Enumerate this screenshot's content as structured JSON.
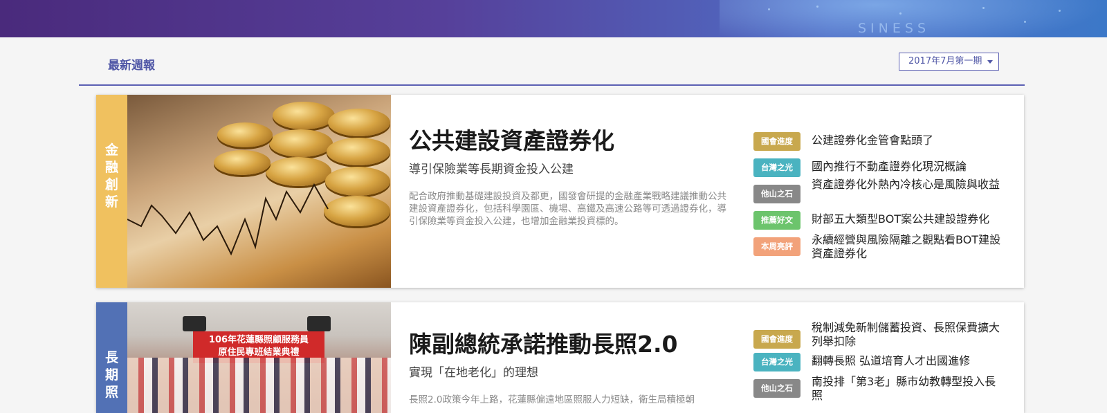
{
  "banner": {
    "text": "SINESS"
  },
  "header": {
    "section_title": "最新週報",
    "issue_selector": "2017年7月第一期"
  },
  "articles": [
    {
      "category": "金\n融\n創\n新",
      "title": "公共建設資產證券化",
      "subtitle": "導引保險業等長期資金投入公建",
      "description": "配合政府推動基礎建設投資及都更，國發會研提的金融產業戰略建議推動公共建設資產證券化，包括科學園區、機場、高鐵及高速公路等可透過證券化，導引保險業等資金投入公建，也增加金融業投資標的。",
      "related": [
        {
          "tag": "國會進度",
          "color": "#c8a84e",
          "text": "公建證券化金管會點頭了"
        },
        {
          "tag": "台灣之光",
          "color": "#4ab3c0",
          "text": "國內推行不動產證券化現況概論"
        },
        {
          "tag": "他山之石",
          "color": "#888888",
          "text": "資產證券化外熱內冷核心是風險與收益"
        },
        {
          "tag": "推薦好文",
          "color": "#6cc46c",
          "text": "財部五大類型BOT案公共建設證券化"
        },
        {
          "tag": "本周亮評",
          "color": "#f2a27a",
          "text": "永續經營與風險隔離之觀點看BOT建設資產證券化"
        }
      ]
    },
    {
      "category": "長\n期\n照",
      "title": "陳副總統承諾推動長照2.0",
      "subtitle": "實現「在地老化」的理想",
      "description": "長照2.0政策今年上路，花蓮縣偏遠地區照服人力短缺，衛生局積極朝",
      "photo_banner": "106年花蓮縣照顧服務員\n原住民專班結業典禮",
      "related": [
        {
          "tag": "國會進度",
          "color": "#c8a84e",
          "text": "稅制減免新制儲蓄投資、長照保費擴大列舉扣除"
        },
        {
          "tag": "台灣之光",
          "color": "#4ab3c0",
          "text": "翻轉長照 弘道培育人才出國進修"
        },
        {
          "tag": "他山之石",
          "color": "#888888",
          "text": "南投排「第3老」縣市幼教轉型投入長照"
        }
      ]
    }
  ]
}
